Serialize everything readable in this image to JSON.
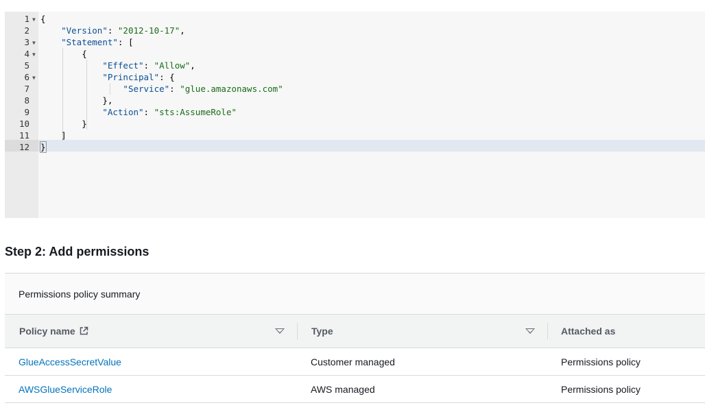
{
  "editor": {
    "lines": [
      {
        "num": "1",
        "fold": true
      },
      {
        "num": "2",
        "fold": false
      },
      {
        "num": "3",
        "fold": true
      },
      {
        "num": "4",
        "fold": true
      },
      {
        "num": "5",
        "fold": false
      },
      {
        "num": "6",
        "fold": true
      },
      {
        "num": "7",
        "fold": false
      },
      {
        "num": "8",
        "fold": false
      },
      {
        "num": "9",
        "fold": false
      },
      {
        "num": "10",
        "fold": false
      },
      {
        "num": "11",
        "fold": false
      },
      {
        "num": "12",
        "fold": false
      }
    ],
    "code": {
      "l1": "{",
      "l2_key": "\"Version\"",
      "l2_val": "\"2012-10-17\"",
      "l3_key": "\"Statement\"",
      "l3_rest": ": [",
      "l4": "{",
      "l5_key": "\"Effect\"",
      "l5_val": "\"Allow\"",
      "l6_key": "\"Principal\"",
      "l6_rest": ": {",
      "l7_key": "\"Service\"",
      "l7_val": "\"glue.amazonaws.com\"",
      "l8": "},",
      "l9_key": "\"Action\"",
      "l9_val": "\"sts:AssumeRole\"",
      "l10": "}",
      "l11": "]",
      "l12": "}"
    },
    "active_line": "12"
  },
  "step": {
    "title": "Step 2: Add permissions"
  },
  "permissions": {
    "panel_title": "Permissions policy summary",
    "columns": {
      "policy_name": "Policy name",
      "type": "Type",
      "attached_as": "Attached as"
    },
    "rows": [
      {
        "policy_name": "GlueAccessSecretValue",
        "type": "Customer managed",
        "attached_as": "Permissions policy"
      },
      {
        "policy_name": "AWSGlueServiceRole",
        "type": "AWS managed",
        "attached_as": "Permissions policy"
      }
    ]
  },
  "icons": {
    "fold": "fold-arrow-icon",
    "sort": "sort-down-icon",
    "external_link": "external-link-icon"
  },
  "colors": {
    "link": "#0073bb",
    "json_key": "#0b4f94",
    "json_string": "#1a6b1a",
    "active_line": "#e1e8f1"
  }
}
